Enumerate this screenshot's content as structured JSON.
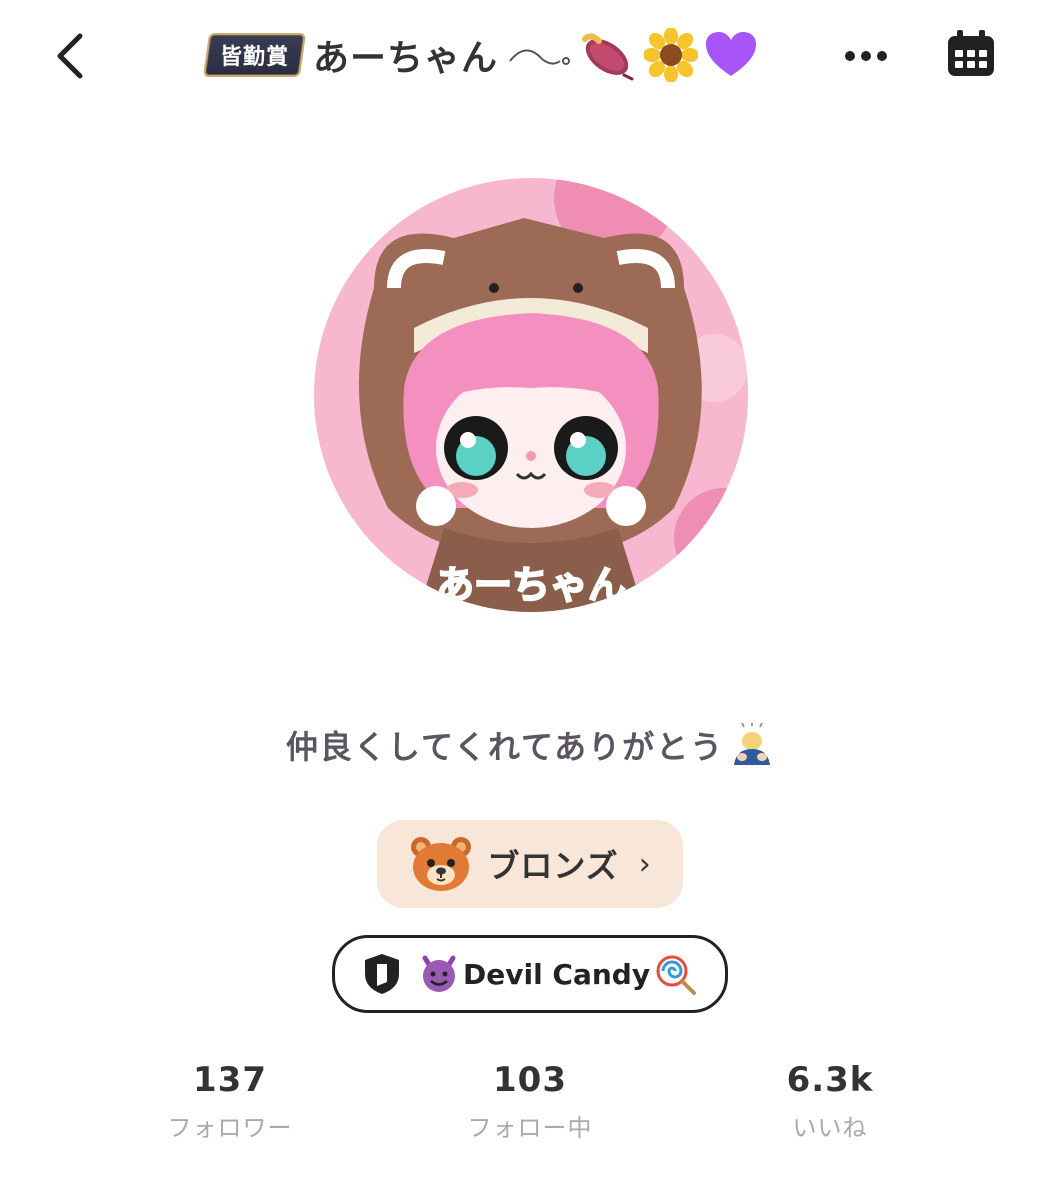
{
  "header": {
    "back_icon": "chevron-left-icon",
    "award_badge": "皆勤賞",
    "username": "あーちゃん",
    "name_decorations": [
      "wave-flourish",
      "sweet-potato-emoji",
      "sunflower-emoji",
      "purple-heart-emoji"
    ],
    "more_icon": "ellipsis-icon",
    "calendar_icon": "calendar-icon"
  },
  "profile": {
    "avatar_name": "あーちゃん",
    "bio": "仲良くしてくれてありがとう",
    "bio_emoji": "bowing-person-emoji",
    "rank": {
      "icon": "bear-face-icon",
      "label": "ブロンズ",
      "chevron": "›"
    },
    "team": {
      "icon": "shield-icon",
      "label": "Devil Candy",
      "prefix_emoji": "smiling-devil-emoji",
      "suffix_emoji": "lollipop-emoji"
    }
  },
  "stats": [
    {
      "value": "137",
      "label": "フォロワー"
    },
    {
      "value": "103",
      "label": "フォロー中"
    },
    {
      "value": "6.3k",
      "label": "いいね"
    }
  ],
  "colors": {
    "rank_bg": "#f8e6d9",
    "award_bg": "#2a2c42",
    "avatar_bg": "#f7b7cf"
  }
}
